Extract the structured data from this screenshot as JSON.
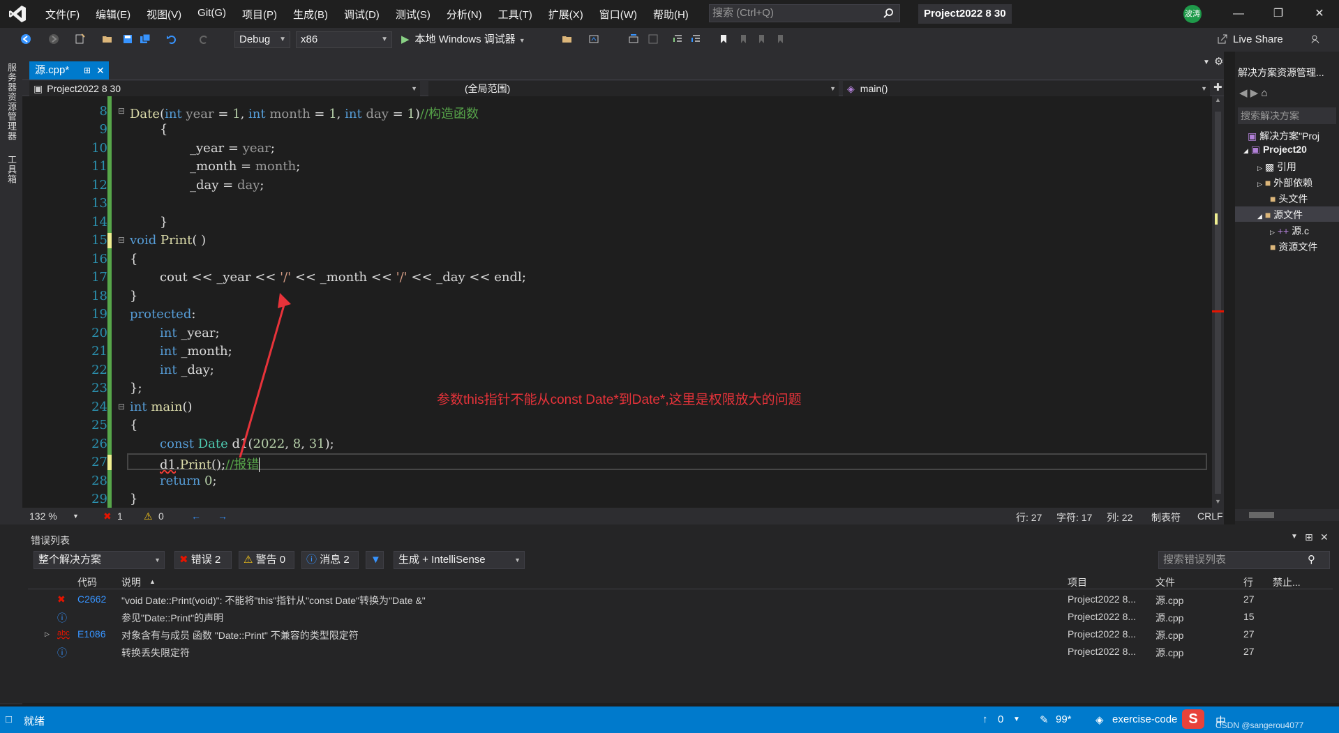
{
  "menu": [
    "文件(F)",
    "编辑(E)",
    "视图(V)",
    "Git(G)",
    "项目(P)",
    "生成(B)",
    "调试(D)",
    "测试(S)",
    "分析(N)",
    "工具(T)",
    "扩展(X)",
    "窗口(W)",
    "帮助(H)"
  ],
  "search": {
    "placeholder": "搜索 (Ctrl+Q)"
  },
  "window": {
    "project_title": "Project2022 8 30",
    "avatar_text": "波涛"
  },
  "toolbar": {
    "config": "Debug",
    "platform": "x86",
    "run_label": "本地 Windows 调试器",
    "live_share": "Live Share"
  },
  "left_strip": {
    "server_explorer": "服务器资源管理器",
    "toolbox": "工具箱"
  },
  "editor": {
    "tab_label": "源.cpp*",
    "nav_project": "Project2022 8 30",
    "nav_scope": "(全局范围)",
    "nav_member": "main()",
    "line_numbers": [
      "8",
      "9",
      "10",
      "11",
      "12",
      "13",
      "14",
      "15",
      "16",
      "17",
      "18",
      "19",
      "20",
      "21",
      "22",
      "23",
      "24",
      "25",
      "26",
      "27",
      "28",
      "29"
    ],
    "annotation": "参数this指针不能从const Date*到Date*,这里是权限放大的问题",
    "code": {
      "l8": {
        "fn": "Date",
        "p1": "(",
        "kw1": "int",
        "pa1": "year",
        "eq1": " = ",
        "n1": "1",
        ",1": ", ",
        "kw2": "int",
        "pa2": "month",
        "eq2": " = ",
        "n2": "1",
        ",2": ", ",
        "kw3": "int",
        "pa3": "day",
        "eq3": " = ",
        "n3": "1",
        "close": ")",
        "comment": "//构造函数"
      },
      "l9": "{",
      "l10": {
        "member": "_year",
        " eq": " = ",
        "param": "year",
        "semi": ";"
      },
      "l11": {
        "member": "_month",
        "eq": " = ",
        "param": "month",
        "semi": ";"
      },
      "l12": {
        "member": "_day",
        "eq": " = ",
        "param": "day",
        "semi": ";"
      },
      "l14": "}",
      "l15": {
        "kw": "void",
        "fn": "Print",
        "rest": "( )"
      },
      "l16": "{",
      "l17": {
        "cout": "cout",
        "op1": " << ",
        "m1": "_year",
        "op2": " << ",
        "s1": "'/'",
        "op3": " << ",
        "m2": "_month",
        "op4": " << ",
        "s2": "'/'",
        "op5": " << ",
        "m3": "_day",
        "op6": " << ",
        "endl": "endl",
        "semi": ";"
      },
      "l18": "}",
      "l19": {
        "kw": "protected",
        "colon": ":"
      },
      "l20": {
        "kw": "int",
        "member": "_year",
        "semi": ";"
      },
      "l21": {
        "kw": "int",
        "member": "_month",
        "semi": ";"
      },
      "l22": {
        "kw": "int",
        "member": "_day",
        "semi": ";"
      },
      "l23": "};",
      "l24": {
        "kw": "int",
        "fn": "main",
        "rest": "()"
      },
      "l25": "{",
      "l26": {
        "kw": "const",
        "ty": "Date",
        "var": "d1",
        "open": "(",
        "n1": "2022",
        "c1": ", ",
        "n2": "8",
        "c2": ", ",
        "n3": "31",
        "close": ");"
      },
      "l27": {
        "var": "d1",
        "dot": ".",
        "fn": "Print",
        "rest": "();",
        "comment": "//报错"
      },
      "l28": {
        "kw": "return",
        "n": "0",
        "semi": ";"
      },
      "l29": "}"
    }
  },
  "editor_status": {
    "zoom": "132 %",
    "errors": "1",
    "warnings": "0",
    "line": "行: 27",
    "char": "字符: 17",
    "col": "列: 22",
    "tabs": "制表符",
    "eol": "CRLF"
  },
  "solution_explorer": {
    "title": "解决方案资源管理...",
    "search_placeholder": "搜索解决方案",
    "items": [
      "解决方案\"Proj",
      "Project20",
      "引用",
      "外部依赖",
      "头文件",
      "源文件",
      "源.c",
      "资源文件"
    ]
  },
  "error_list": {
    "title": "错误列表",
    "scope": "整个解决方案",
    "errors_btn": "错误 2",
    "warnings_btn": "警告 0",
    "messages_btn": "消息 2",
    "build_filter": "生成 + IntelliSense",
    "search_placeholder": "搜索错误列表",
    "columns": [
      "代码",
      "说明",
      "项目",
      "文件",
      "行",
      "禁止..."
    ],
    "rows": [
      {
        "code": "C2662",
        "desc": "\"void Date::Print(void)\": 不能将\"this\"指针从\"const Date\"转换为\"Date &\"",
        "project": "Project2022 8...",
        "file": "源.cpp",
        "line": "27"
      },
      {
        "code": "",
        "desc": "参见\"Date::Print\"的声明",
        "project": "Project2022 8...",
        "file": "源.cpp",
        "line": "15"
      },
      {
        "code": "E1086",
        "desc": "对象含有与成员 函数 \"Date::Print\" 不兼容的类型限定符",
        "project": "Project2022 8...",
        "file": "源.cpp",
        "line": "27"
      },
      {
        "code": "",
        "desc": "转换丢失限定符",
        "project": "Project2022 8...",
        "file": "源.cpp",
        "line": "27"
      }
    ]
  },
  "status_bar": {
    "ready": "就绪",
    "up": "0",
    "pencil": "99*",
    "branch": "exercise-code",
    "ime": "中",
    "watermark": "CSDN @sangerou4077"
  },
  "colors": {
    "accent": "#007acc",
    "keyword": "#569cd6",
    "comment": "#57a64a",
    "error": "#e51400",
    "annotation": "#e8333a"
  }
}
